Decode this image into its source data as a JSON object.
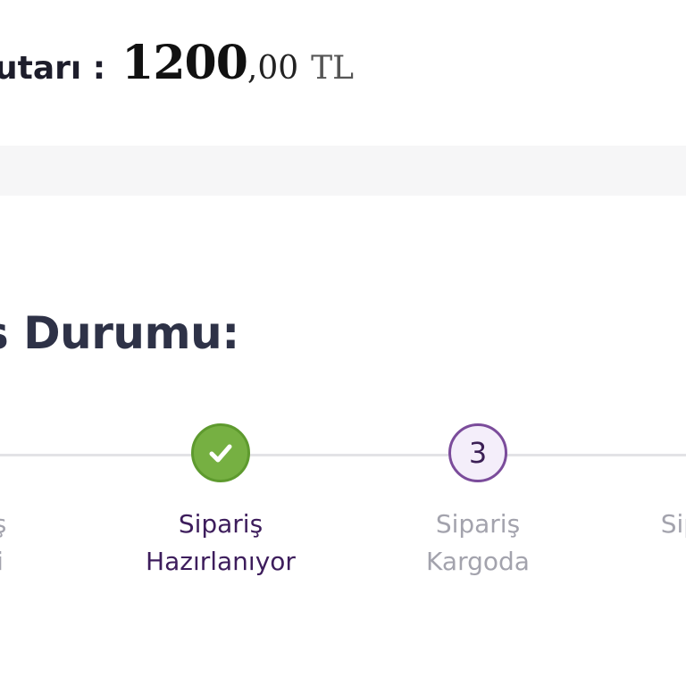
{
  "summary": {
    "total_label": "utarı :",
    "total_integer": "1200",
    "total_decimal": ",00",
    "total_currency": "TL"
  },
  "order_status": {
    "title": "ş Durumu:",
    "steps": [
      {
        "line1": "ş",
        "line2": "i",
        "state": "done",
        "indicator": ""
      },
      {
        "line1": "Sipariş",
        "line2": "Hazırlanıyor",
        "state": "done",
        "indicator": "check-icon"
      },
      {
        "line1": "Sipariş",
        "line2": "Kargoda",
        "state": "pending",
        "indicator": "3"
      },
      {
        "line1": "Sipa",
        "line2": "",
        "state": "pending",
        "indicator": ""
      }
    ]
  },
  "colors": {
    "done_green": "#76b042",
    "active_purple": "#3d1d5c",
    "pending_border": "#7b4c9b",
    "inactive_text": "#a3a3ad",
    "title_color": "#2e3247"
  }
}
